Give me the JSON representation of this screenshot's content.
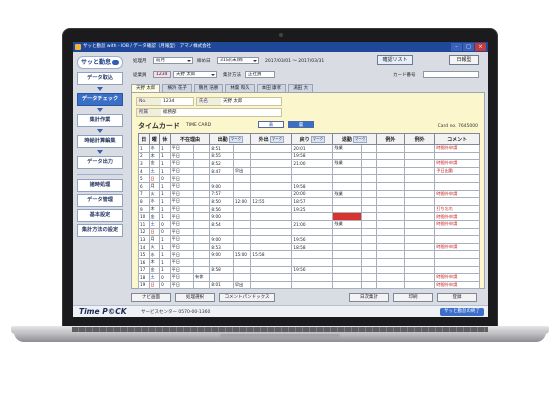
{
  "window": {
    "title": "サッと勤怠 with - IOB / データ確認（月報型）  アマノ株式会社"
  },
  "logo": {
    "text": "サッと勤怠"
  },
  "sidebar": {
    "items": [
      {
        "label": "データ取込"
      },
      {
        "label": "データチェック"
      },
      {
        "label": "集計作業"
      },
      {
        "label": "時給計算編集"
      },
      {
        "label": "データ出力"
      },
      {
        "label": "諸時処理"
      },
      {
        "label": "データ管理"
      },
      {
        "label": "基本設定"
      },
      {
        "label": "集計方法の設定"
      }
    ]
  },
  "filter": {
    "period_label": "処理月",
    "period_value": "前月",
    "cutoff_label": "締め日",
    "cutoff_value": "31日(末)締",
    "date_range": "2017/03/01 〜 2017/03/31",
    "confirm_list_button": "確認リスト",
    "daily_report_button": "日報型",
    "employee_label": "従業員",
    "employee_code": "1234",
    "employee_name": "天野 太郎",
    "aggregate_label": "集計方法",
    "aggregate_value": "正社員",
    "card_no_label": "カード番号"
  },
  "tabs": [
    {
      "label": "天野 太郎"
    },
    {
      "label": "横浜 花子"
    },
    {
      "label": "鶴見 浩勝"
    },
    {
      "label": "林葉 和久"
    },
    {
      "label": "本田 康孝"
    },
    {
      "label": "湯田 大"
    }
  ],
  "employee": {
    "no_label": "No.",
    "no_value": "1234",
    "name_label": "氏名",
    "name_value": "天野 太郎",
    "dept_label": "所属",
    "dept_value": "総務部"
  },
  "timecard": {
    "title": "タイムカード",
    "subtitle": "TIME CARD",
    "toggle_left": "表",
    "toggle_right": "裏",
    "card_no": "Card no. 7645000",
    "columns": [
      "日",
      "曜",
      "休",
      "不在理由",
      "出勤",
      "外出",
      "戻り",
      "退勤",
      "例外",
      "例外",
      "コメント"
    ],
    "mark": "マーク",
    "rows": [
      [
        "1",
        "水",
        "1",
        "平日",
        "",
        "8:51",
        "",
        "",
        "20:01",
        "残業",
        "",
        "",
        "時間外申請"
      ],
      [
        "2",
        "木",
        "1",
        "平日",
        "",
        "8:55",
        "",
        "",
        "19:58",
        "",
        "",
        "",
        ""
      ],
      [
        "3",
        "金",
        "1",
        "平日",
        "",
        "8:52",
        "",
        "",
        "21:00",
        "残業",
        "",
        "",
        "時間外申請"
      ],
      [
        "4",
        "土",
        "1",
        "平日",
        "",
        "8:47",
        "早出",
        "",
        "",
        "",
        "",
        "",
        "予日出勤"
      ],
      [
        "5",
        "日",
        "0",
        "平日",
        "",
        "",
        "",
        "",
        "",
        "",
        "",
        "",
        ""
      ],
      [
        "6",
        "月",
        "1",
        "平日",
        "",
        "9:00",
        "",
        "",
        "19:58",
        "",
        "",
        "",
        ""
      ],
      [
        "7",
        "火",
        "1",
        "平日",
        "",
        "7:57",
        "",
        "",
        "20:00",
        "残業",
        "",
        "",
        "時間外申請"
      ],
      [
        "8",
        "水",
        "1",
        "平日",
        "",
        "8:50",
        "12:00",
        "12:55",
        "18:57",
        "",
        "",
        "",
        ""
      ],
      [
        "9",
        "木",
        "1",
        "平日",
        "",
        "8:56",
        "",
        "",
        "19:25",
        "",
        "",
        "",
        "打ち忘れ"
      ],
      [
        "10",
        "金",
        "1",
        "平日",
        "",
        "9:00",
        "",
        "",
        "",
        "",
        "",
        "",
        "時間外申請"
      ],
      [
        "11",
        "土",
        "0",
        "平日",
        "",
        "8:54",
        "",
        "",
        "21:00",
        "残業",
        "",
        "",
        "時間外申請"
      ],
      [
        "12",
        "日",
        "0",
        "平日",
        "",
        "",
        "",
        "",
        "",
        "",
        "",
        "",
        ""
      ],
      [
        "13",
        "月",
        "1",
        "平日",
        "",
        "9:00",
        "",
        "",
        "19:56",
        "",
        "",
        "",
        ""
      ],
      [
        "14",
        "火",
        "1",
        "平日",
        "",
        "8:53",
        "",
        "",
        "18:58",
        "",
        "",
        "",
        "時間外申請"
      ],
      [
        "15",
        "水",
        "1",
        "平日",
        "",
        "9:00",
        "15:00",
        "15:58",
        "",
        "",
        "",
        "",
        ""
      ],
      [
        "16",
        "木",
        "1",
        "平日",
        "",
        "",
        "",
        "",
        "",
        "",
        "",
        "",
        ""
      ],
      [
        "17",
        "金",
        "1",
        "平日",
        "",
        "8:58",
        "",
        "",
        "19:56",
        "",
        "",
        "",
        ""
      ],
      [
        "18",
        "土",
        "0",
        "平日",
        "有休",
        "",
        "",
        "",
        "",
        "",
        "",
        "",
        "時間外申請"
      ],
      [
        "19",
        "日",
        "0",
        "平日",
        "",
        "8:01",
        "早出",
        "",
        "",
        "",
        "",
        "",
        "時間外申請"
      ]
    ]
  },
  "bottom_buttons": {
    "main_menu": "ナビ画面",
    "process": "処理選択",
    "comment": "コメントパンドックス",
    "daily_total": "日次集計",
    "print": "印刷",
    "save": "登録"
  },
  "footer": {
    "brand": "Time P©CK",
    "support": "サービスセンター  0570-00-1360",
    "exit_button": "サッと勤怠の終了"
  },
  "colors": {
    "accent": "#3a6fc6",
    "panel": "#fbf6cc",
    "titlebar": "#20489a",
    "alert": "#d8332e"
  }
}
